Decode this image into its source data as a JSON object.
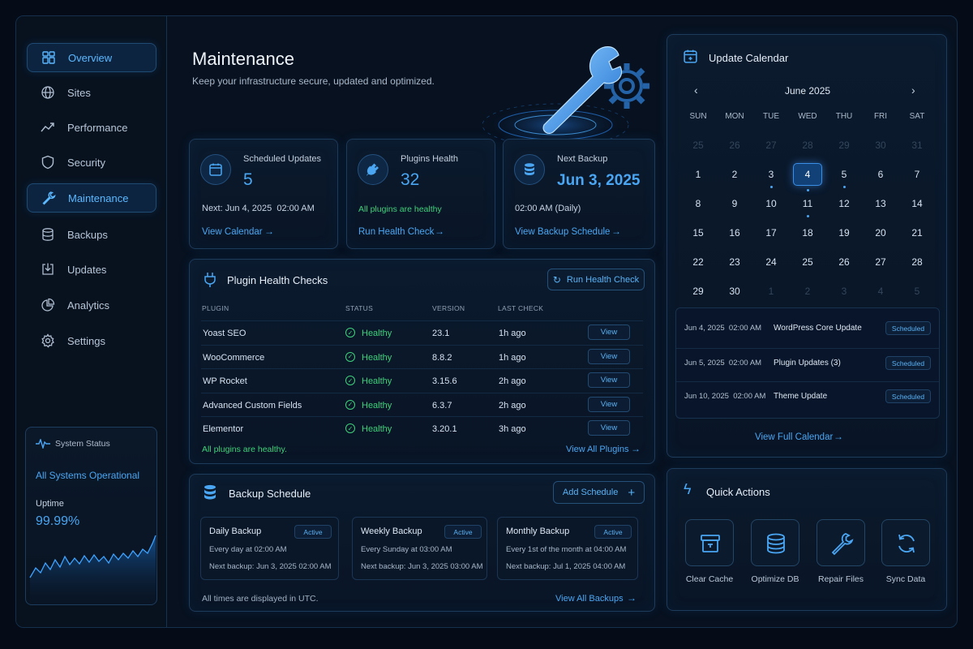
{
  "sidebar": {
    "items": [
      {
        "label": "Overview",
        "icon": "overview-icon"
      },
      {
        "label": "Sites",
        "icon": "globe-icon"
      },
      {
        "label": "Performance",
        "icon": "trend-icon"
      },
      {
        "label": "Security",
        "icon": "shield-icon"
      },
      {
        "label": "Maintenance",
        "icon": "wrench-icon"
      },
      {
        "label": "Backups",
        "icon": "database-icon"
      },
      {
        "label": "Updates",
        "icon": "update-icon"
      },
      {
        "label": "Analytics",
        "icon": "pie-icon"
      },
      {
        "label": "Settings",
        "icon": "gear-icon"
      }
    ],
    "active": "Maintenance",
    "status": {
      "title": "System Status",
      "state": "All Systems Operational",
      "uptime_label": "Uptime",
      "uptime_value": "99.99%"
    }
  },
  "header": {
    "title": "Maintenance",
    "subtitle": "Keep your infrastructure secure, updated and optimized."
  },
  "stats": {
    "scheduled": {
      "label": "Scheduled Updates",
      "value": "5",
      "detail": "Next: Jun 4, 2025  02:00 AM",
      "link": "View Calendar"
    },
    "plugins": {
      "label": "Plugins Health",
      "value": "32",
      "detail": "All plugins are healthy",
      "link": "Run Health Check"
    },
    "backup": {
      "label": "Next Backup",
      "value": "Jun 3, 2025",
      "detail": "02:00 AM (Daily)",
      "link": "View Backup Schedule"
    }
  },
  "plugin_checks": {
    "title": "Plugin Health Checks",
    "run_button": "Run Health Check",
    "columns": [
      "PLUGIN",
      "STATUS",
      "VERSION",
      "LAST CHECK"
    ],
    "rows": [
      {
        "plugin": "Yoast SEO",
        "status": "Healthy",
        "version": "23.1",
        "last": "1h ago",
        "action": "View"
      },
      {
        "plugin": "WooCommerce",
        "status": "Healthy",
        "version": "8.8.2",
        "last": "1h ago",
        "action": "View"
      },
      {
        "plugin": "WP Rocket",
        "status": "Healthy",
        "version": "3.15.6",
        "last": "2h ago",
        "action": "View"
      },
      {
        "plugin": "Advanced Custom Fields",
        "status": "Healthy",
        "version": "6.3.7",
        "last": "2h ago",
        "action": "View"
      },
      {
        "plugin": "Elementor",
        "status": "Healthy",
        "version": "3.20.1",
        "last": "3h ago",
        "action": "View"
      }
    ],
    "footer_note": "All plugins are healthy.",
    "footer_link": "View All Plugins"
  },
  "backup_schedule": {
    "title": "Backup Schedule",
    "add_button": "Add Schedule",
    "items": [
      {
        "name": "Daily Backup",
        "badge": "Active",
        "freq": "Every day at 02:00 AM",
        "next": "Next backup: Jun 3, 2025 02:00 AM"
      },
      {
        "name": "Weekly Backup",
        "badge": "Active",
        "freq": "Every Sunday at 03:00 AM",
        "next": "Next backup: Jun 3, 2025 03:00 AM"
      },
      {
        "name": "Monthly Backup",
        "badge": "Active",
        "freq": "Every 1st of the month at 04:00 AM",
        "next": "Next backup: Jul 1, 2025 04:00 AM"
      }
    ],
    "footer_note": "All times are displayed in UTC.",
    "footer_link": "View All Backups"
  },
  "calendar": {
    "title": "Update Calendar",
    "month": "June 2025",
    "weekdays": [
      "SUN",
      "MON",
      "TUE",
      "WED",
      "THU",
      "FRI",
      "SAT"
    ],
    "weeks": [
      [
        "25",
        "26",
        "27",
        "28",
        "29",
        "30",
        "31"
      ],
      [
        "1",
        "2",
        "3",
        "4",
        "5",
        "6",
        "7"
      ],
      [
        "8",
        "9",
        "10",
        "11",
        "12",
        "13",
        "14"
      ],
      [
        "15",
        "16",
        "17",
        "18",
        "19",
        "20",
        "21"
      ],
      [
        "22",
        "23",
        "24",
        "25",
        "26",
        "27",
        "28"
      ],
      [
        "29",
        "30",
        "1",
        "2",
        "3",
        "4",
        "5"
      ]
    ],
    "dim_cells": [
      "0-0",
      "0-1",
      "0-2",
      "0-3",
      "0-4",
      "0-5",
      "0-6",
      "5-2",
      "5-3",
      "5-4",
      "5-5",
      "5-6"
    ],
    "today": "1-3",
    "dotted": [
      "1-2",
      "1-3",
      "1-4",
      "2-3"
    ],
    "events": [
      {
        "when": "Jun 4, 2025  02:00 AM",
        "title": "WordPress Core Update",
        "badge": "Scheduled"
      },
      {
        "when": "Jun 5, 2025  02:00 AM",
        "title": "Plugin Updates (3)",
        "badge": "Scheduled"
      },
      {
        "when": "Jun 10, 2025  02:00 AM",
        "title": "Theme Update",
        "badge": "Scheduled"
      }
    ],
    "footer_link": "View Full Calendar"
  },
  "quick_actions": {
    "title": "Quick Actions",
    "items": [
      {
        "label": "Clear Cache",
        "icon": "cache-icon"
      },
      {
        "label": "Optimize DB",
        "icon": "database-icon"
      },
      {
        "label": "Repair Files",
        "icon": "wrench-icon"
      },
      {
        "label": "Sync Data",
        "icon": "sync-icon"
      }
    ]
  },
  "colors": {
    "accent": "#4aa6f2",
    "healthy": "#3fd17a",
    "background": "#07111f"
  }
}
